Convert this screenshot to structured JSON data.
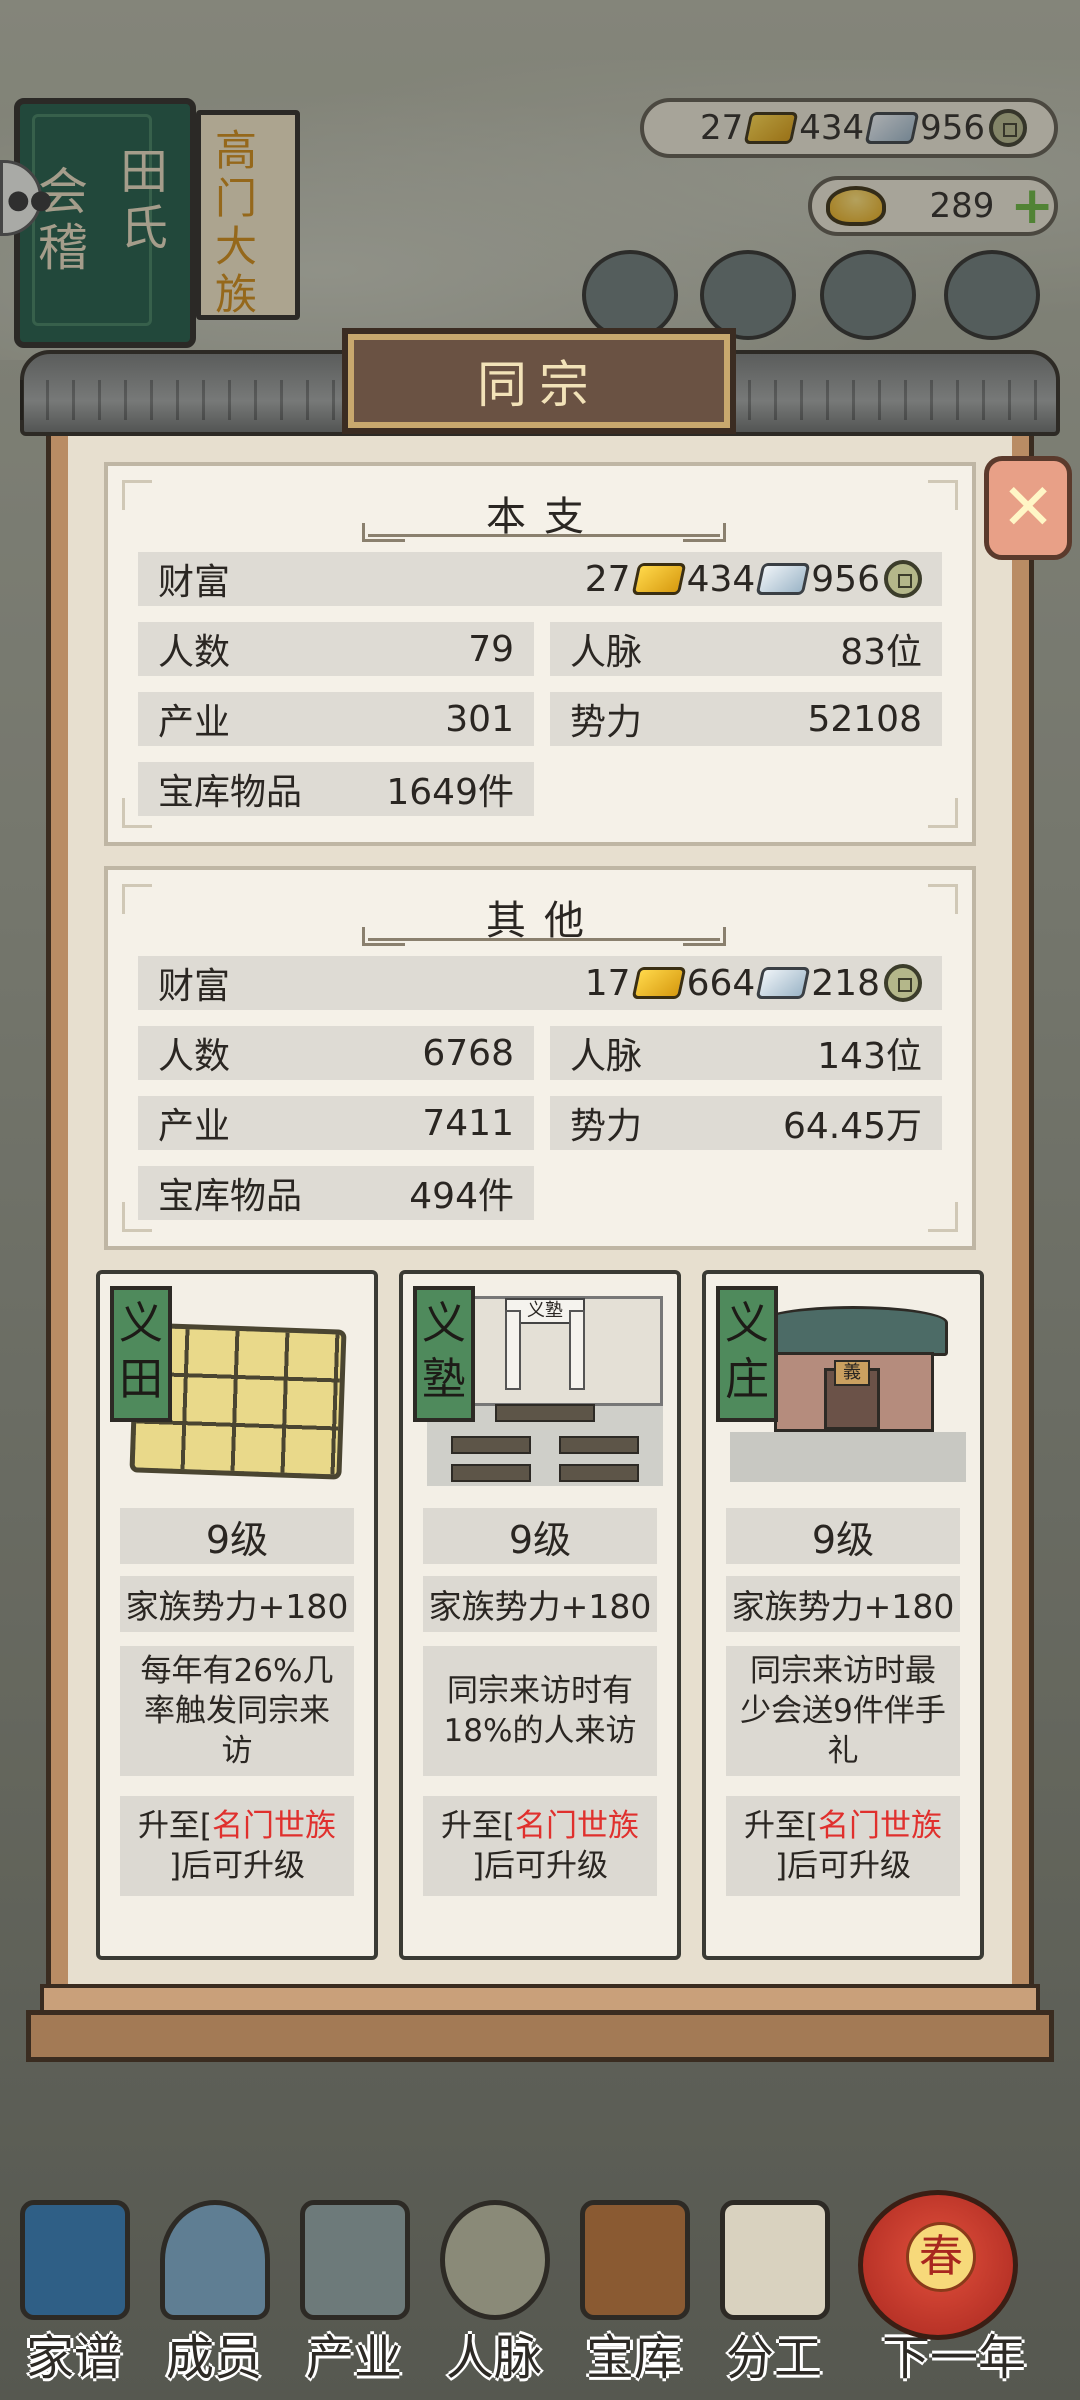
{
  "topbar": {
    "family_surname": "田氏",
    "family_place": "会稽",
    "family_rank": "高门大族",
    "currency": {
      "gold": "27",
      "silver": "434",
      "copper": "956"
    },
    "ingots": "289"
  },
  "dialog": {
    "title": "同宗",
    "main": {
      "title": "本支",
      "wealth_label": "财富",
      "wealth": {
        "gold": "27",
        "silver": "434",
        "copper": "956"
      },
      "people_label": "人数",
      "people": "79",
      "network_label": "人脉",
      "network": "83位",
      "industry_label": "产业",
      "industry": "301",
      "power_label": "势力",
      "power": "52108",
      "vault_label": "宝库物品",
      "vault": "1649件"
    },
    "other": {
      "title": "其他",
      "wealth_label": "财富",
      "wealth": {
        "gold": "17",
        "silver": "664",
        "copper": "218"
      },
      "people_label": "人数",
      "people": "6768",
      "network_label": "人脉",
      "network": "143位",
      "industry_label": "产业",
      "industry": "7411",
      "power_label": "势力",
      "power": "64.45万",
      "vault_label": "宝库物品",
      "vault": "494件"
    },
    "cards": [
      {
        "tag": "义田",
        "level": "9级",
        "power": "家族势力+180",
        "desc": "每年有26%几率触发同宗来访",
        "up_prefix": "升至[",
        "up_rank": "名门世族",
        "up_suffix": "]后可升级"
      },
      {
        "tag": "义塾",
        "level": "9级",
        "power": "家族势力+180",
        "desc": "同宗来访时有18%的人来访",
        "up_prefix": "升至[",
        "up_rank": "名门世族",
        "up_suffix": "]后可升级"
      },
      {
        "tag": "义庄",
        "level": "9级",
        "power": "家族势力+180",
        "desc": "同宗来访时最少会送9件伴手礼",
        "up_prefix": "升至[",
        "up_rank": "名门世族",
        "up_suffix": "]后可升级"
      }
    ],
    "school_sign": "义塾",
    "house_sign": "義"
  },
  "nav": {
    "items": [
      "家谱",
      "成员",
      "产业",
      "人脉",
      "宝库",
      "分工",
      "下一年"
    ],
    "lantern": "春"
  },
  "colors": {
    "accent_red": "#e0302d",
    "tag_green": "#4f8a5c",
    "plus_green": "#67b43c"
  }
}
